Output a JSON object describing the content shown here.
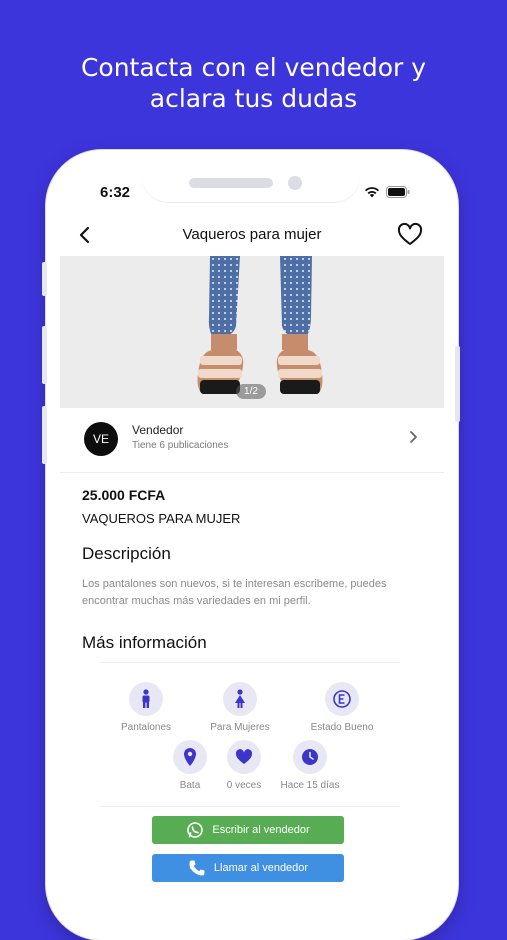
{
  "promo": {
    "line1": "Contacta con el vendedor y",
    "line2": "aclara tus dudas"
  },
  "status_bar": {
    "time": "6:32"
  },
  "header": {
    "title": "Vaqueros para mujer"
  },
  "gallery": {
    "counter": "1/2"
  },
  "seller": {
    "initials": "VE",
    "name": "Vendedor",
    "subtitle": "Tiene 6 publicaciones"
  },
  "product": {
    "price": "25.000 FCFA",
    "name": "VAQUEROS PARA MUJER",
    "description_heading": "Descripción",
    "description": "Los pantalones son nuevos, si te interesan escribeme, puedes encontrar muchas más variedades en mi perfil.",
    "more_info_heading": "Más información"
  },
  "details": [
    {
      "label": "Pantalones",
      "icon": "person-icon"
    },
    {
      "label": "Para Mujeres",
      "icon": "woman-icon"
    },
    {
      "label": "Estado Bueno",
      "icon": "condition-icon"
    },
    {
      "label": "Bata",
      "icon": "location-pin-icon"
    },
    {
      "label": "0 veces",
      "icon": "heart-icon"
    },
    {
      "label": "Hace 15 días",
      "icon": "clock-icon"
    }
  ],
  "actions": {
    "whatsapp_label": "Escribir al vendedor",
    "call_label": "Llamar al vendedor"
  },
  "colors": {
    "background": "#3d35dc",
    "icon_accent": "#3b36c8",
    "whatsapp_button": "#58ad54",
    "call_button": "#3f8fe3"
  }
}
